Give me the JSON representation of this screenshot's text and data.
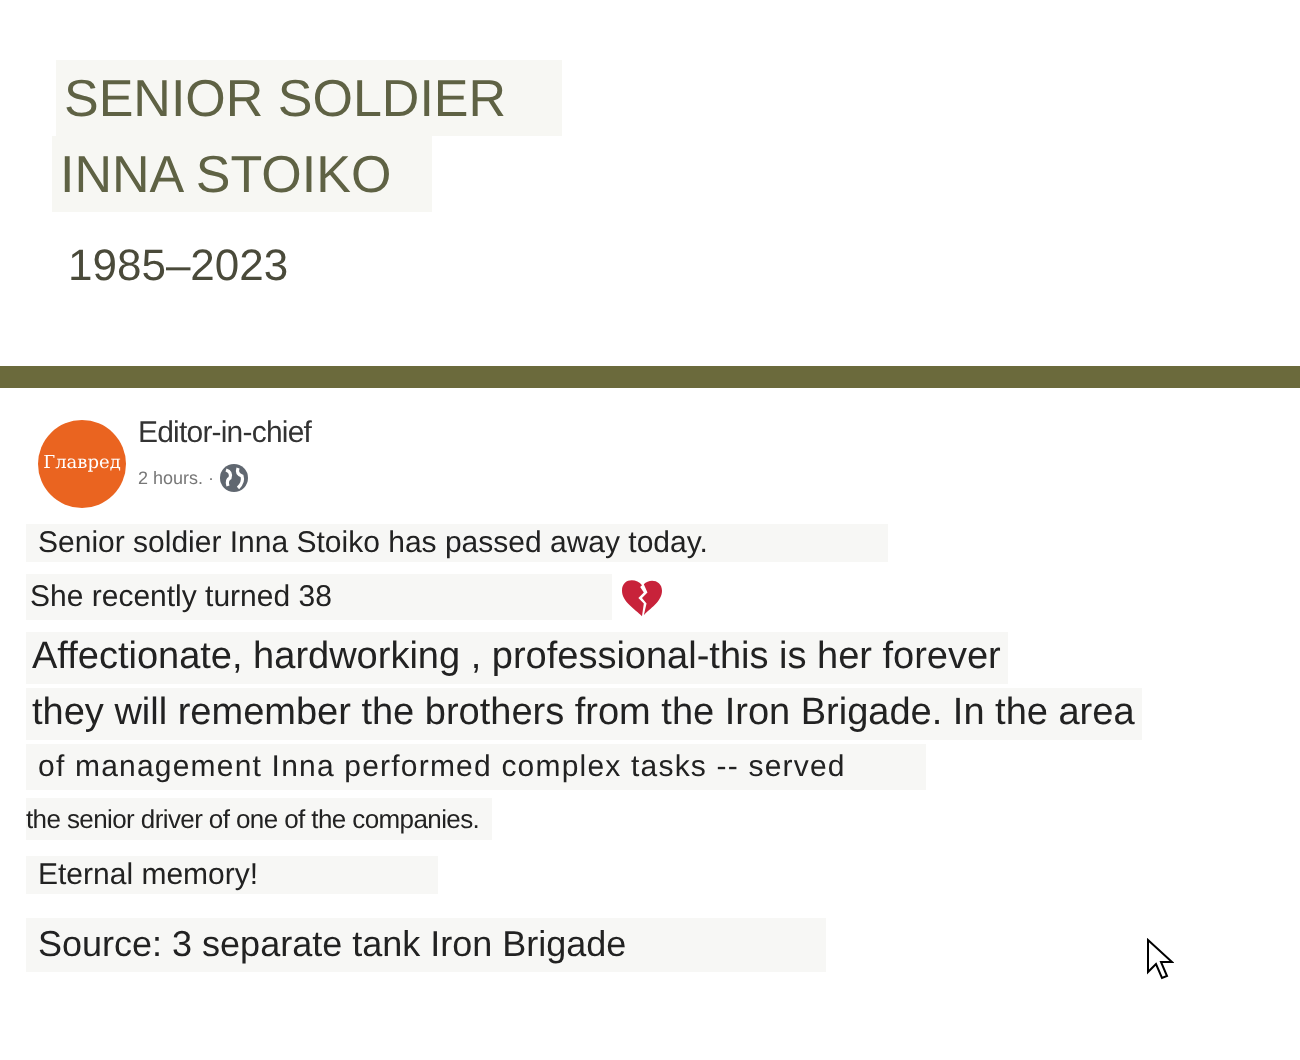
{
  "header": {
    "title_lines": [
      "SENIOR SOLDIER",
      "INNA STOIKO"
    ],
    "years": "1985–2023"
  },
  "post": {
    "avatar_text": "Главред",
    "author": "Editor-in-chief",
    "time": "2 hours. ·",
    "lines": [
      {
        "text": "Senior soldier Inna Stoiko has passed away today.",
        "kind": "medium"
      },
      {
        "text": "She recently turned 38",
        "kind": "heart"
      },
      {
        "text": "Affectionate, hardworking , professional-this is her forever",
        "kind": "large"
      },
      {
        "text": "they will remember the brothers from the Iron Brigade. In the area",
        "kind": "large"
      },
      {
        "text": "of management Inna performed complex tasks -- served",
        "kind": "wide"
      },
      {
        "text": "the senior driver of one of the companies.",
        "kind": "narrow"
      },
      {
        "text": "Eternal memory!",
        "kind": "medium"
      },
      {
        "text": "Source: 3 separate tank Iron Brigade",
        "kind": "source"
      }
    ]
  }
}
